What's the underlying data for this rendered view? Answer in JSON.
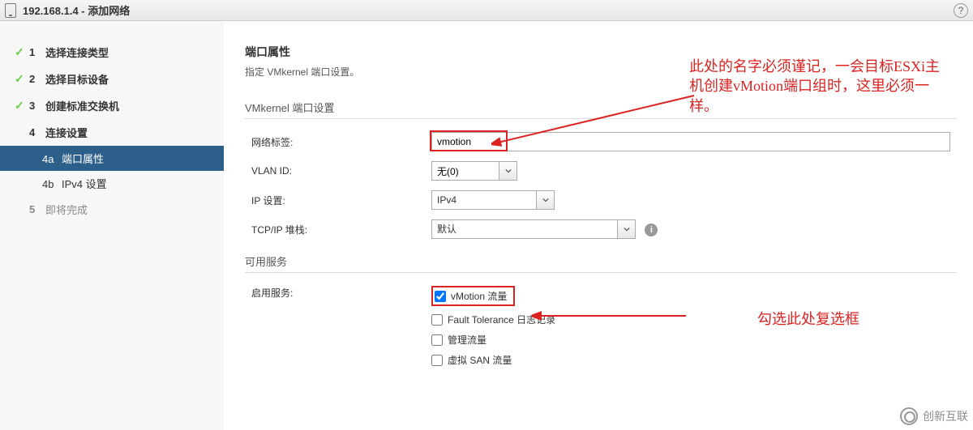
{
  "titlebar": {
    "title": "192.168.1.4 - 添加网络"
  },
  "steps": {
    "s1": "选择连接类型",
    "s2": "选择目标设备",
    "s3": "创建标准交换机",
    "s4": "连接设置",
    "s4a_num": "4a",
    "s4a": "端口属性",
    "s4b_num": "4b",
    "s4b": "IPv4 设置",
    "s5": "即将完成"
  },
  "page": {
    "heading": "端口属性",
    "sub": "指定 VMkernel 端口设置。",
    "group1": "VMkernel 端口设置",
    "labels": {
      "net_label": "网络标签:",
      "vlan": "VLAN ID:",
      "ip": "IP 设置:",
      "tcpip": "TCP/IP 堆栈:"
    },
    "values": {
      "net_label": "vmotion",
      "vlan": "无(0)",
      "ip": "IPv4",
      "tcpip": "默认"
    },
    "group2": "可用服务",
    "services_label": "启用服务:",
    "services": {
      "vmotion": "vMotion 流量",
      "ft": "Fault Tolerance 日志记录",
      "mgmt": "管理流量",
      "vsan": "虚拟 SAN 流量"
    }
  },
  "annotations": {
    "a1": "此处的名字必须谨记，一会目标ESXi主机创建vMotion端口组时，这里必须一样。",
    "a2": "勾选此处复选框"
  },
  "watermark": "创新互联"
}
